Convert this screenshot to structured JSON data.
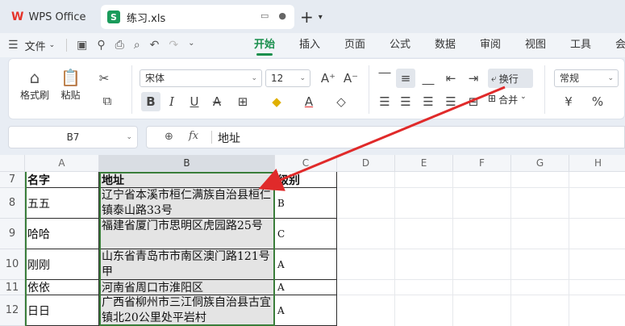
{
  "app": {
    "brand": "WPS Office",
    "file_tab": "练习.xls",
    "file_icon": "S"
  },
  "menu": {
    "file": "文件",
    "tabs": [
      "开始",
      "插入",
      "页面",
      "公式",
      "数据",
      "审阅",
      "视图",
      "工具",
      "会员"
    ],
    "active_tab": "开始"
  },
  "ribbon": {
    "format_painter": "格式刷",
    "paste": "粘贴",
    "font_name": "宋体",
    "font_size": "12",
    "wrap_text": "换行",
    "number_format": "常规",
    "merge": "合并",
    "currency": "¥",
    "percent": "%"
  },
  "formula_bar": {
    "name_box": "B7",
    "fx": "fx",
    "value": "地址"
  },
  "grid": {
    "columns": [
      "A",
      "B",
      "C",
      "D",
      "E",
      "F",
      "G",
      "H"
    ],
    "selected_column": "B",
    "rows": [
      {
        "num": "7",
        "name": "名字",
        "address": "地址",
        "grade": "级别"
      },
      {
        "num": "8",
        "name": "五五",
        "address": "辽宁省本溪市桓仁满族自治县桓仁镇泰山路33号",
        "grade": "B"
      },
      {
        "num": "9",
        "name": "哈哈",
        "address": "福建省厦门市思明区虎园路25号",
        "grade": "C"
      },
      {
        "num": "10",
        "name": "刚刚",
        "address": "山东省青岛市市南区澳门路121号甲",
        "grade": "A"
      },
      {
        "num": "11",
        "name": "依依",
        "address": "河南省周口市淮阳区",
        "grade": "A"
      },
      {
        "num": "12",
        "name": "日日",
        "address": "广西省柳州市三江侗族自治县古宜镇北20公里处平岩村",
        "grade": "A"
      }
    ]
  },
  "colors": {
    "accent": "#1a8f4d",
    "selection_border": "#3a7e3a",
    "arrow": "#e02a2a"
  }
}
